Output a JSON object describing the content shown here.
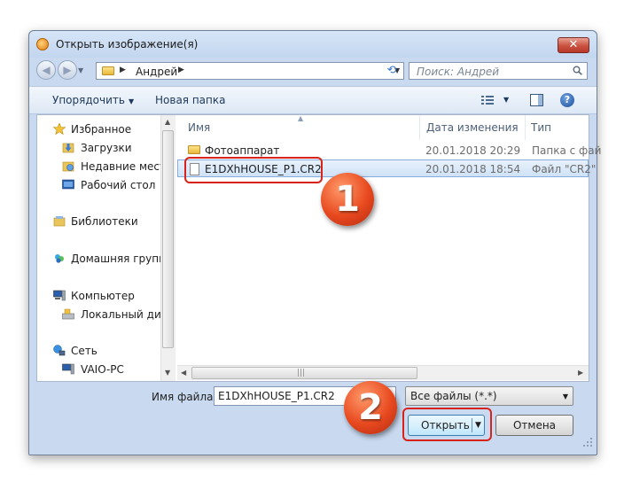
{
  "window": {
    "title": "Открыть изображение(я)",
    "close_glyph": "✕"
  },
  "nav": {
    "back_glyph": "◀",
    "forward_glyph": "▶",
    "dropdown_glyph": "▼",
    "address_path": [
      "Андрей"
    ],
    "address_sep_glyph": "▶",
    "refresh_glyph": "⟲",
    "search_placeholder": "Поиск: Андрей"
  },
  "toolbar": {
    "organize_label": "Упорядочить",
    "new_folder_label": "Новая папка",
    "caret": "▼",
    "help_glyph": "?"
  },
  "sidebar": {
    "items": [
      {
        "label": "Избранное",
        "icon": "star-icon"
      },
      {
        "label": "Загрузки",
        "icon": "downloads-icon"
      },
      {
        "label": "Недавние места",
        "icon": "recent-places-icon"
      },
      {
        "label": "Рабочий стол",
        "icon": "desktop-icon"
      },
      {
        "label": "Библиотеки",
        "icon": "libraries-icon"
      },
      {
        "label": "Домашняя группа",
        "icon": "homegroup-icon"
      },
      {
        "label": "Компьютер",
        "icon": "computer-icon"
      },
      {
        "label": "Локальный диск",
        "icon": "local-disk-icon"
      },
      {
        "label": "Сеть",
        "icon": "network-icon"
      },
      {
        "label": "VAIO-PC",
        "icon": "pc-icon"
      }
    ],
    "scroll_up": "▲",
    "scroll_down": "▼"
  },
  "files": {
    "columns": [
      "Имя",
      "Дата изменения",
      "Тип"
    ],
    "sort_glyph": "▲",
    "rows": [
      {
        "name": "Фотоаппарат",
        "date": "20.01.2018 20:29",
        "type": "Папка с фай",
        "icon": "folder-icon",
        "selected": false
      },
      {
        "name": "E1DXhHOUSE_P1.CR2",
        "date": "20.01.2018 18:54",
        "type": "Файл \"CR2\"",
        "icon": "file-icon",
        "selected": true
      }
    ],
    "scroll_left": "◀",
    "scroll_right": "▶",
    "grip": "|||"
  },
  "bottom": {
    "filename_label": "Имя файла:",
    "filename_value": "E1DXhHOUSE_P1.CR2",
    "filter_value": "Все файлы (*.*)",
    "filter_caret": "▼",
    "open_label": "Открыть",
    "open_caret": "▼",
    "cancel_label": "Отмена"
  },
  "annotations": {
    "badge1": "1",
    "badge2": "2"
  },
  "colors": {
    "accent_red": "#d9221a",
    "selection": "#cfe2f7",
    "badge": "#e8491f"
  }
}
